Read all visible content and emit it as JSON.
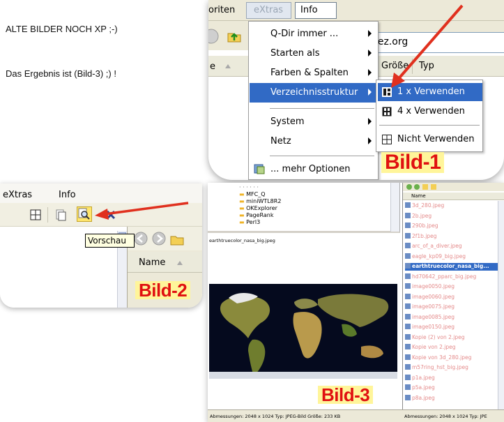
{
  "intro": {
    "line1": "ALTE BILDER NOCH XP ;-)",
    "line2": "Das Ergebnis ist (Bild-3) ;) !"
  },
  "bild1": {
    "label": "Bild-1",
    "menubar": {
      "favoriten_fragment": "oriten",
      "extras": "eXtras",
      "info": "Info"
    },
    "address_fragment": "lez.org",
    "column_left_fragment": "e",
    "columns": [
      "Größe",
      "Typ"
    ],
    "menu_items": [
      {
        "label": "Q-Dir immer ...",
        "submenu": true
      },
      {
        "label": "Starten als",
        "submenu": true
      },
      {
        "label": "Farben & Spalten",
        "submenu": true
      },
      {
        "label": "Verzeichnisstruktur",
        "submenu": true,
        "highlighted": true
      },
      {
        "label": "System",
        "submenu": true
      },
      {
        "label": "Netz",
        "submenu": true
      },
      {
        "label": "... mehr Optionen",
        "submenu": false
      }
    ],
    "submenu_items": [
      {
        "label": "1 x Verwenden",
        "highlighted": true,
        "icon": "tree-one-icon"
      },
      {
        "label": "4 x Verwenden",
        "highlighted": false,
        "icon": "tree-four-icon"
      },
      {
        "label": "Nicht Verwenden",
        "highlighted": false,
        "icon": "tree-none-icon"
      }
    ]
  },
  "bild2": {
    "label": "Bild-2",
    "menubar": {
      "extras": "eXtras",
      "info": "Info"
    },
    "tooltip": "Vorschau",
    "column": "Name"
  },
  "bild3": {
    "label": "Bild-3",
    "tree_items": [
      "MFC_Q",
      "miniWTL8R2",
      "OKExplorer",
      "PageRank",
      "Perl3"
    ],
    "preview_caption": "earthtruecolor_nasa_big.jpeg",
    "list_header": "Name",
    "files": [
      "3d_280.jpeg",
      "2b.jpeg",
      "290b.jpeg",
      "2f1b.jpeg",
      "arc_of_a_diver.jpeg",
      "eagle_kp09_big.jpeg",
      "earthtruecolor_nasa_big...",
      "hd70642_pparc_big.jpeg",
      "image0050.jpeg",
      "image0060.jpeg",
      "image0075.jpeg",
      "image0085.jpeg",
      "image0150.jpeg",
      "Kopie (2) von 2.jpeg",
      "Kopie von 2.jpeg",
      "Kopie von 3d_280.jpeg",
      "m57ring_hst_big.jpeg",
      "p1a.jpeg",
      "p5a.jpeg",
      "p8a.jpeg"
    ],
    "selected_file_index": 6,
    "status_left": "Abmessungen: 2048 x 1024 Typ: JPEG-Bild Größe: 233 KB",
    "status_right": "Abmessungen: 2048 x 1024 Typ: JPE"
  },
  "colors": {
    "highlight": "#316ac5",
    "badge_text": "#e01010",
    "badge_bg": "#fff59a",
    "arrow": "#e0301e",
    "xp_face": "#ece9d8"
  }
}
